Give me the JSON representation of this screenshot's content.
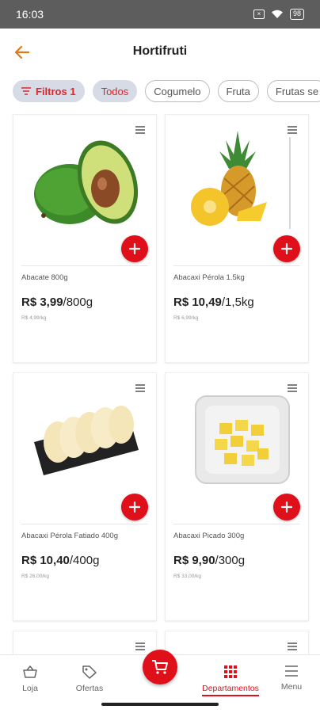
{
  "status": {
    "time": "16:03",
    "battery": "98"
  },
  "header": {
    "title": "Hortifruti"
  },
  "chips": {
    "filter_label": "Filtros 1",
    "items": [
      "Todos",
      "Cogumelo",
      "Fruta",
      "Frutas se"
    ]
  },
  "products": [
    {
      "name": "Abacate 800g",
      "price": "R$ 3,99",
      "unit": "/800g",
      "unit_price": "R$ 4,99/kg",
      "icon": "avocado-image"
    },
    {
      "name": "Abacaxi Pérola 1.5kg",
      "price": "R$ 10,49",
      "unit": "/1,5kg",
      "unit_price": "R$ 6,99/kg",
      "icon": "pineapple-image"
    },
    {
      "name": "Abacaxi Pérola Fatiado 400g",
      "price": "R$ 10,40",
      "unit": "/400g",
      "unit_price": "R$ 26,00/kg",
      "icon": "sliced-pineapple-image"
    },
    {
      "name": "Abacaxi Picado 300g",
      "price": "R$ 9,90",
      "unit": "/300g",
      "unit_price": "R$ 33,00/kg",
      "icon": "diced-pineapple-image"
    }
  ],
  "nav": {
    "items": [
      "Loja",
      "Ofertas",
      "Departamentos",
      "Menu"
    ]
  },
  "colors": {
    "accent": "#e0101b",
    "back_arrow": "#e07a1a",
    "chip_active_bg": "#d6dbe6"
  }
}
